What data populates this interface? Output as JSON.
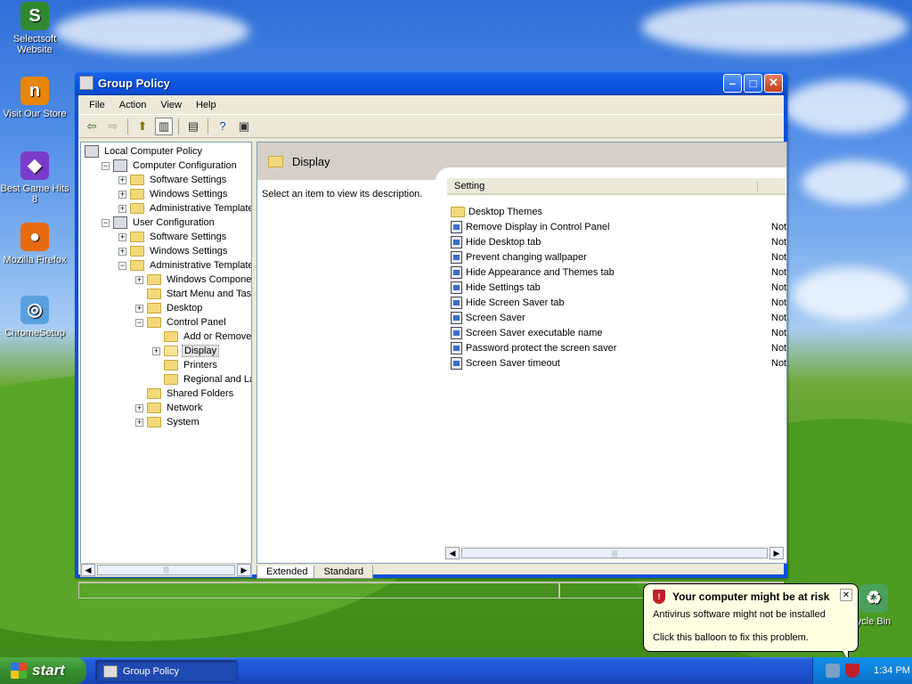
{
  "desktop": {
    "icons": [
      {
        "label": "Selectsoft Website",
        "glyph": "S",
        "color": "#2f8a2f"
      },
      {
        "label": "Visit Our Store",
        "glyph": "n",
        "color": "#e8860c"
      },
      {
        "label": "Best Game Hits 8",
        "glyph": "◆",
        "color": "#7a3bc8"
      },
      {
        "label": "Mozilla Firefox",
        "glyph": "●",
        "color": "#e86a10"
      },
      {
        "label": "ChromeSetup",
        "glyph": "◎",
        "color": "#5aa0e0"
      },
      {
        "label": "ycle Bin",
        "glyph": "♻",
        "color": "#4aa05a"
      }
    ]
  },
  "window": {
    "title": "Group Policy",
    "menu": [
      "File",
      "Action",
      "View",
      "Help"
    ]
  },
  "tree": [
    {
      "label": "Local Computer Policy",
      "depth": 0,
      "toggle": "",
      "icon": "computer"
    },
    {
      "label": "Computer Configuration",
      "depth": 1,
      "toggle": "−",
      "icon": "computer"
    },
    {
      "label": "Software Settings",
      "depth": 2,
      "toggle": "+",
      "icon": "folder"
    },
    {
      "label": "Windows Settings",
      "depth": 2,
      "toggle": "+",
      "icon": "folder"
    },
    {
      "label": "Administrative Templates",
      "depth": 2,
      "toggle": "+",
      "icon": "folder"
    },
    {
      "label": "User Configuration",
      "depth": 1,
      "toggle": "−",
      "icon": "user"
    },
    {
      "label": "Software Settings",
      "depth": 2,
      "toggle": "+",
      "icon": "folder"
    },
    {
      "label": "Windows Settings",
      "depth": 2,
      "toggle": "+",
      "icon": "folder"
    },
    {
      "label": "Administrative Templates",
      "depth": 2,
      "toggle": "−",
      "icon": "folder"
    },
    {
      "label": "Windows Components",
      "depth": 3,
      "toggle": "+",
      "icon": "folder"
    },
    {
      "label": "Start Menu and Taskba",
      "depth": 3,
      "toggle": "",
      "icon": "folder"
    },
    {
      "label": "Desktop",
      "depth": 3,
      "toggle": "+",
      "icon": "folder"
    },
    {
      "label": "Control Panel",
      "depth": 3,
      "toggle": "−",
      "icon": "folder"
    },
    {
      "label": "Add or Remove Pro",
      "depth": 4,
      "toggle": "",
      "icon": "folder"
    },
    {
      "label": "Display",
      "depth": 4,
      "toggle": "+",
      "icon": "folder-open",
      "selected": true
    },
    {
      "label": "Printers",
      "depth": 4,
      "toggle": "",
      "icon": "folder"
    },
    {
      "label": "Regional and Langu",
      "depth": 4,
      "toggle": "",
      "icon": "folder"
    },
    {
      "label": "Shared Folders",
      "depth": 3,
      "toggle": "",
      "icon": "folder"
    },
    {
      "label": "Network",
      "depth": 3,
      "toggle": "+",
      "icon": "folder"
    },
    {
      "label": "System",
      "depth": 3,
      "toggle": "+",
      "icon": "folder"
    }
  ],
  "details": {
    "heading": "Display",
    "description": "Select an item to view its description.",
    "column_setting": "Setting",
    "rows": [
      {
        "name": "Desktop Themes",
        "type": "folder",
        "state": ""
      },
      {
        "name": "Remove Display in Control Panel",
        "type": "policy",
        "state": "Not"
      },
      {
        "name": "Hide Desktop tab",
        "type": "policy",
        "state": "Not"
      },
      {
        "name": "Prevent changing wallpaper",
        "type": "policy",
        "state": "Not"
      },
      {
        "name": "Hide Appearance and Themes tab",
        "type": "policy",
        "state": "Not"
      },
      {
        "name": "Hide Settings tab",
        "type": "policy",
        "state": "Not"
      },
      {
        "name": "Hide Screen Saver tab",
        "type": "policy",
        "state": "Not"
      },
      {
        "name": "Screen Saver",
        "type": "policy",
        "state": "Not"
      },
      {
        "name": "Screen Saver executable name",
        "type": "policy",
        "state": "Not"
      },
      {
        "name": "Password protect the screen saver",
        "type": "policy",
        "state": "Not"
      },
      {
        "name": "Screen Saver timeout",
        "type": "policy",
        "state": "Not"
      }
    ],
    "tabs": [
      "Extended",
      "Standard"
    ]
  },
  "balloon": {
    "title": "Your computer might be at risk",
    "line1": "Antivirus software might not be installed",
    "line2": "Click this balloon to fix this problem."
  },
  "taskbar": {
    "start_label": "start",
    "task_label": "Group Policy",
    "clock": "1:34 PM"
  }
}
